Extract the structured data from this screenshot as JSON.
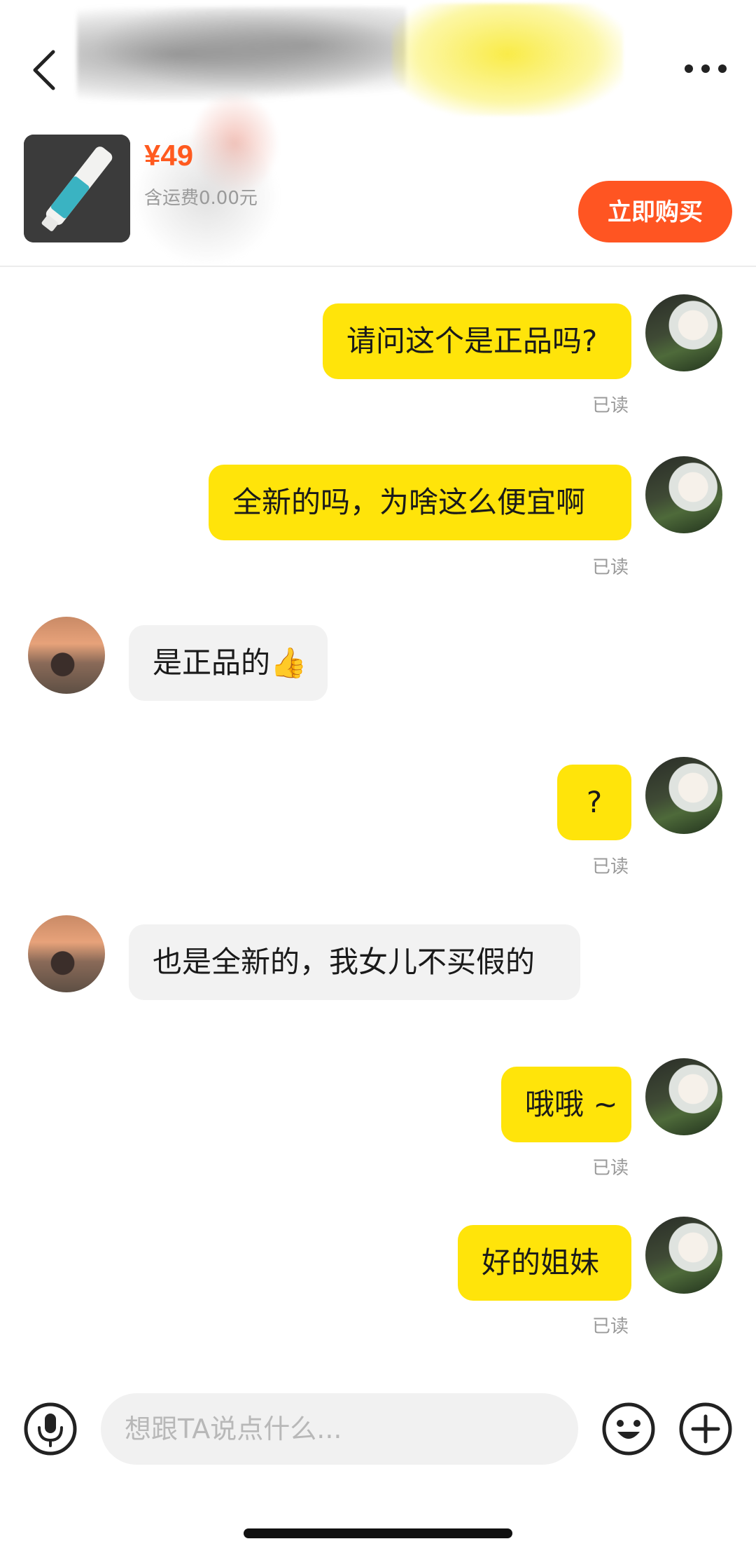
{
  "header": {
    "seller_name": "",
    "product": {
      "price": "¥49",
      "shipping": "含运费0.00元"
    },
    "buy_button": "立即购买",
    "back_icon": "back-arrow-icon",
    "more_icon": "more-horizontal-icon"
  },
  "messages": [
    {
      "from": "me",
      "text": "请问这个是正品吗?",
      "status": "已读"
    },
    {
      "from": "me",
      "text": "全新的吗，为啥这么便宜啊",
      "status": "已读"
    },
    {
      "from": "seller",
      "text": "是正品的👍"
    },
    {
      "from": "me",
      "text": "?",
      "status": "已读"
    },
    {
      "from": "seller",
      "text": "也是全新的，我女儿不买假的"
    },
    {
      "from": "me",
      "text": "哦哦 ~",
      "status": "已读"
    },
    {
      "from": "me",
      "text": "好的姐妹",
      "status": "已读"
    }
  ],
  "input_bar": {
    "placeholder": "想跟TA说点什么...",
    "value": "",
    "icons": [
      "microphone-icon",
      "emoji-icon",
      "plus-icon"
    ]
  },
  "colors": {
    "accent": "#ff5522",
    "price": "#ff5a1f",
    "my_bubble": "#ffe40a",
    "seller_bubble": "#f2f2f2"
  }
}
